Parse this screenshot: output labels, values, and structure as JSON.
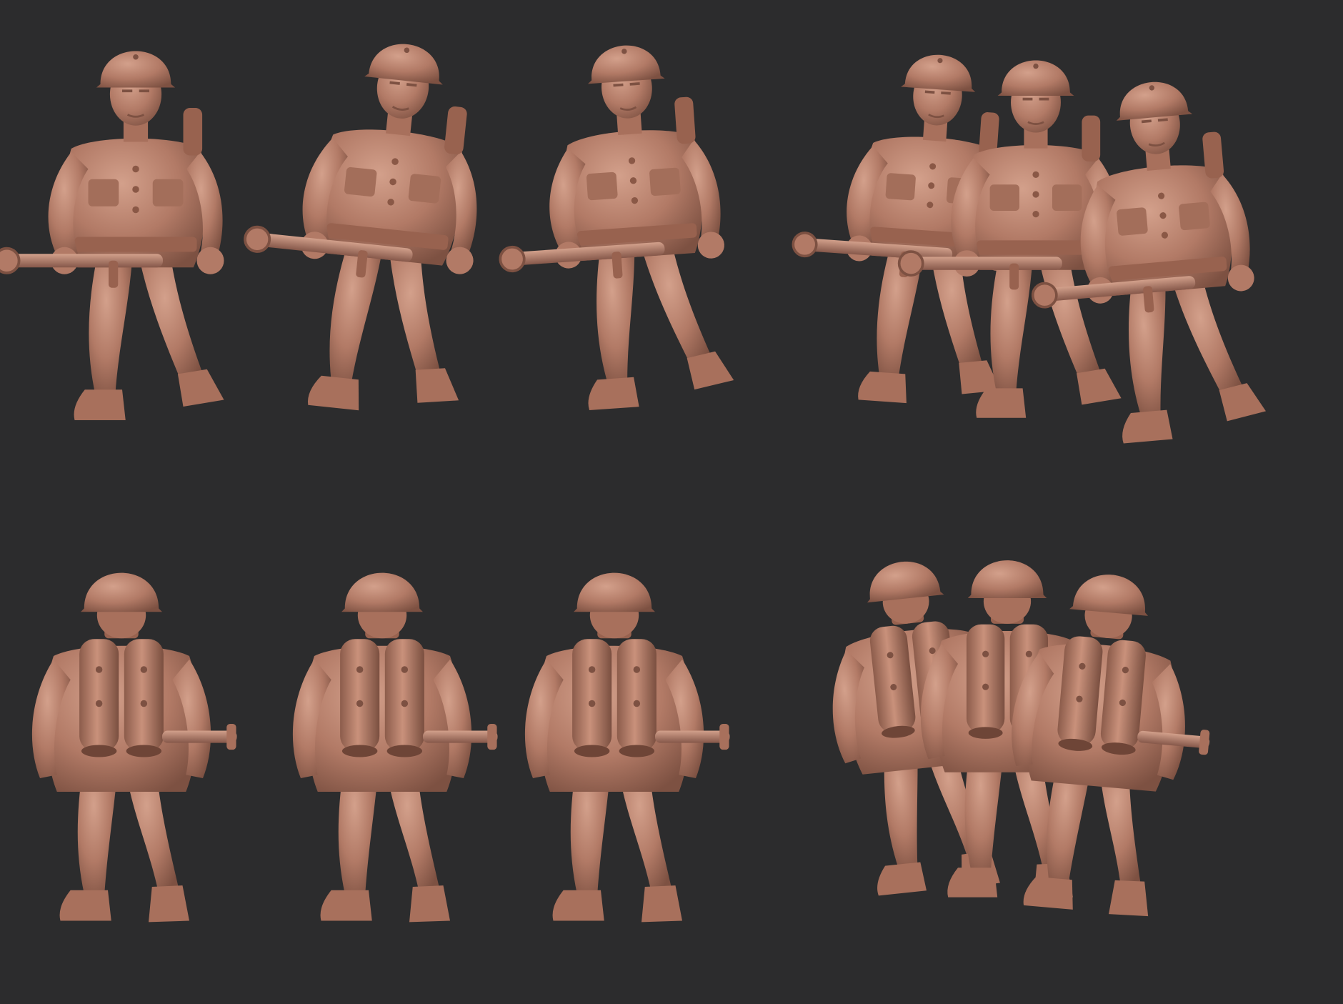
{
  "scene": {
    "background_color": "#2c2c2d",
    "figure_color": "#b27a66",
    "figure_shadow": "#7d5142",
    "figure_highlight": "#cf9a85",
    "rows": [
      {
        "view": "front",
        "groups": [
          {
            "label": "",
            "figures": 3
          },
          {
            "label": "",
            "figures": 3,
            "overlapping": true
          }
        ]
      },
      {
        "view": "back",
        "groups": [
          {
            "label": "",
            "figures": 3
          },
          {
            "label": "",
            "figures": 3,
            "overlapping": true
          }
        ]
      }
    ],
    "subject": "flamethrower-soldier-miniatures"
  }
}
